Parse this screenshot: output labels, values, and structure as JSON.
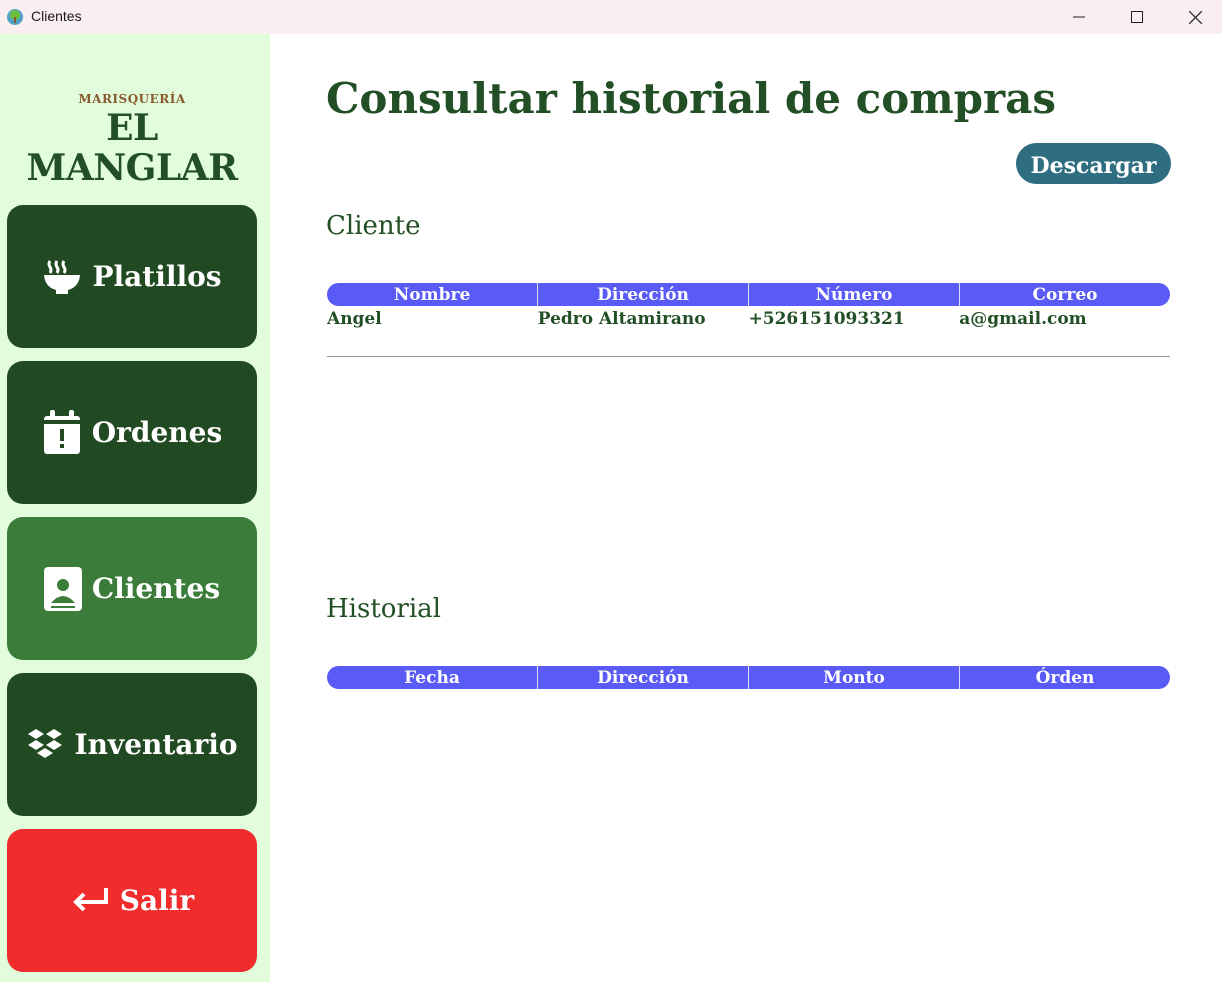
{
  "window": {
    "title": "Clientes",
    "controls": {
      "minimize": "minimize-icon",
      "maximize": "maximize-icon",
      "close": "close-icon"
    }
  },
  "sidebar": {
    "logo": {
      "subtitle": "MARISQUERÍA",
      "name": "EL MANGLAR"
    },
    "items": [
      {
        "label": "Platillos",
        "icon": "bowl-steam-icon",
        "active": false
      },
      {
        "label": "Ordenes",
        "icon": "calendar-alert-icon",
        "active": false
      },
      {
        "label": "Clientes",
        "icon": "contact-card-icon",
        "active": true
      },
      {
        "label": "Inventario",
        "icon": "dropbox-boxes-icon",
        "active": false
      },
      {
        "label": "Salir",
        "icon": "return-arrow-icon",
        "active": false
      }
    ]
  },
  "main": {
    "title": "Consultar historial de compras",
    "download_label": "Descargar",
    "client_section": {
      "title": "Cliente",
      "columns": [
        "Nombre",
        "Dirección",
        "Número",
        "Correo"
      ],
      "rows": [
        [
          "Angel",
          "Pedro Altamirano",
          "+526151093321",
          "a@gmail.com"
        ]
      ]
    },
    "history_section": {
      "title": "Historial",
      "columns": [
        "Fecha",
        "Dirección",
        "Monto",
        "Órden"
      ],
      "rows": []
    }
  },
  "colors": {
    "sidebar_bg": "#e1fddb",
    "nav_dark": "#224a22",
    "nav_active": "#3b7c3b",
    "exit_red": "#f02c2c",
    "header_blue": "#5a5af7",
    "download_teal": "#2f6e80",
    "title_green": "#234f26"
  }
}
